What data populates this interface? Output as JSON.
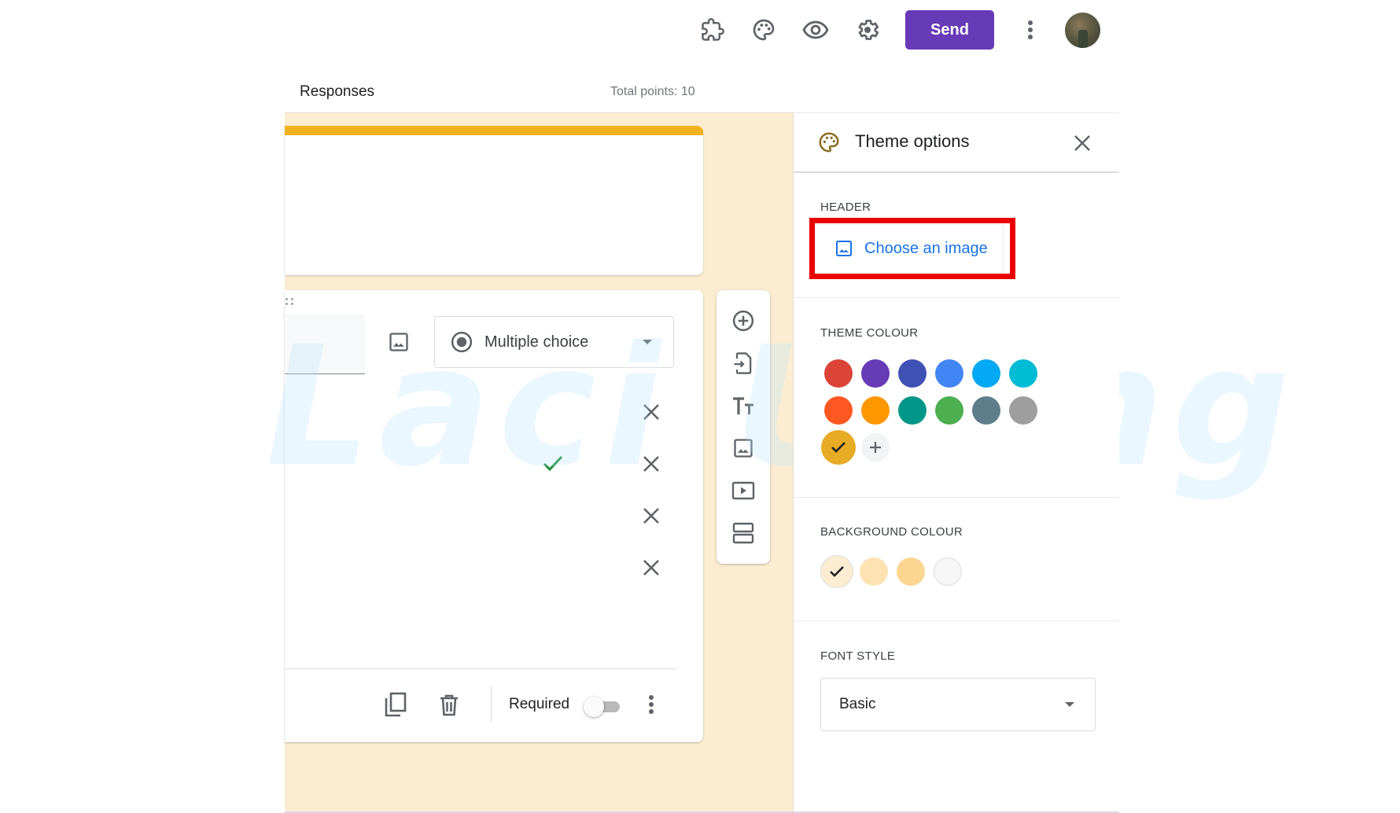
{
  "topbar": {
    "icons": [
      {
        "name": "add-ons-icon",
        "label": "Add-ons"
      },
      {
        "name": "palette-icon",
        "label": "Customise theme"
      },
      {
        "name": "preview-eye-icon",
        "label": "Preview"
      },
      {
        "name": "settings-gear-icon",
        "label": "Settings"
      }
    ],
    "send_label": "Send",
    "more_icon": "more-vert-icon",
    "avatar": "user-avatar"
  },
  "tabs": {
    "responses_label": "Responses",
    "total_points": "Total points: 10"
  },
  "form": {
    "header_accent_color": "#f0b21f",
    "canvas_background": "#fcedd2",
    "question": {
      "type_label": "Multiple choice",
      "options_count": 4,
      "correct_option_index": 1
    },
    "footer": {
      "required_label": "Required",
      "required_on": false
    },
    "side_tools": [
      {
        "name": "add-question-icon",
        "label": "Add question"
      },
      {
        "name": "import-questions-icon",
        "label": "Import questions"
      },
      {
        "name": "add-title-icon",
        "label": "Add title and description"
      },
      {
        "name": "add-image-icon",
        "label": "Add image"
      },
      {
        "name": "add-video-icon",
        "label": "Add video"
      },
      {
        "name": "add-section-icon",
        "label": "Add section"
      }
    ]
  },
  "watermark": "Laci Using",
  "theme_panel": {
    "title": "Theme options",
    "header_section": {
      "label": "HEADER",
      "choose_image_label": "Choose an image"
    },
    "theme_colour": {
      "label": "THEME COLOUR",
      "swatches": [
        "#db4437",
        "#673ab7",
        "#3f51b5",
        "#4285f4",
        "#03a9f4",
        "#00bcd4",
        "#ff5722",
        "#ff9800",
        "#009688",
        "#4caf50",
        "#607d8b",
        "#9e9e9e",
        "#e8ab26"
      ],
      "selected_index": 12,
      "add_custom_label": "+"
    },
    "background_colour": {
      "label": "BACKGROUND COLOUR",
      "swatches": [
        "#fcedd2",
        "#fde3b2",
        "#fbd691",
        "#f6f6f6"
      ],
      "selected_index": 0
    },
    "font_style": {
      "label": "FONT STYLE",
      "selected": "Basic"
    }
  }
}
